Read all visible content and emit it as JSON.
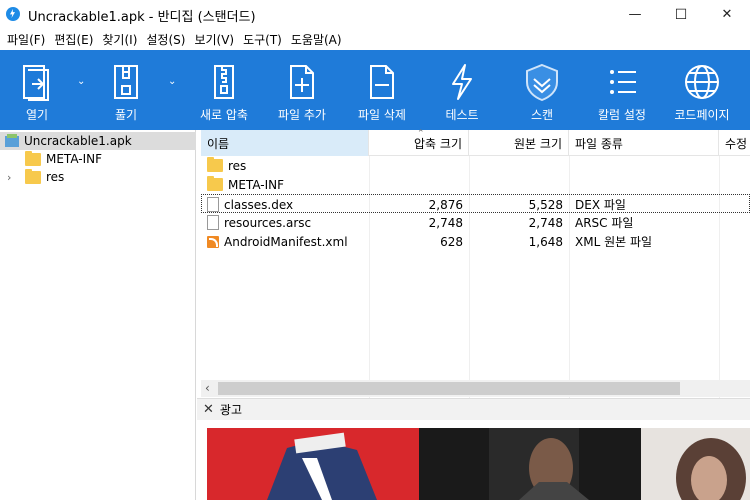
{
  "window": {
    "title": "Uncrackable1.apk - 반디집 (스탠더드)",
    "minimize": "—",
    "maximize": "☐",
    "close": "✕"
  },
  "menu": [
    "파일(F)",
    "편집(E)",
    "찾기(I)",
    "설정(S)",
    "보기(V)",
    "도구(T)",
    "도움말(A)"
  ],
  "toolbar": {
    "open": "열기",
    "extract": "풀기",
    "new_archive": "새로 압축",
    "add_file": "파일 추가",
    "delete_file": "파일 삭제",
    "test": "테스트",
    "scan": "스캔",
    "column_settings": "칼럼 설정",
    "codepage": "코드페이지",
    "accent_color": "#1f7bd9"
  },
  "tree": {
    "root": "Uncrackable1.apk",
    "children": [
      "META-INF",
      "res"
    ]
  },
  "list": {
    "columns": [
      "이름",
      "압축 크기",
      "원본 크기",
      "파일 종류",
      "수정"
    ],
    "rows": [
      {
        "name": "res",
        "packed": "",
        "original": "",
        "type": "",
        "icon": "folder-icon"
      },
      {
        "name": "META-INF",
        "packed": "",
        "original": "",
        "type": "",
        "icon": "folder-icon"
      },
      {
        "name": "classes.dex",
        "packed": "2,876",
        "original": "5,528",
        "type": "DEX 파일",
        "icon": "file-icon"
      },
      {
        "name": "resources.arsc",
        "packed": "2,748",
        "original": "2,748",
        "type": "ARSC 파일",
        "icon": "file-icon"
      },
      {
        "name": "AndroidManifest.xml",
        "packed": "628",
        "original": "1,648",
        "type": "XML 원본 파일",
        "icon": "xml-file-icon"
      }
    ]
  },
  "ad": {
    "close": "✕",
    "label": "광고"
  }
}
